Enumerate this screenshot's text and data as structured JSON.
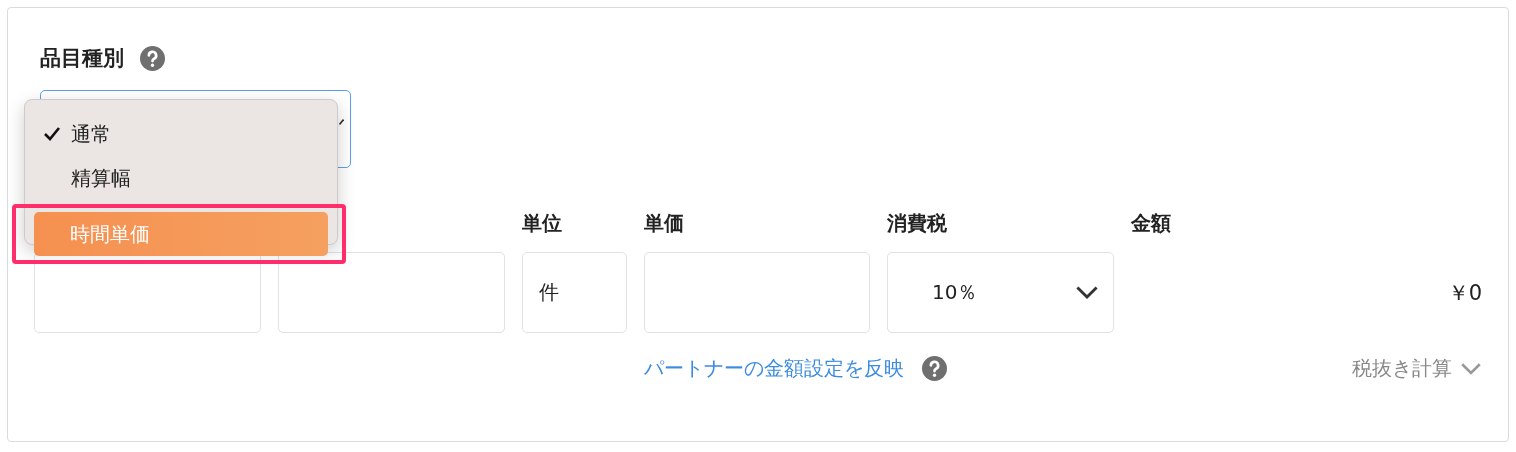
{
  "item_type": {
    "label": "品目種別",
    "menu": [
      {
        "label": "通常",
        "checked": true,
        "selected": false,
        "outlined": false
      },
      {
        "label": "精算幅",
        "checked": false,
        "selected": false,
        "outlined": false
      },
      {
        "label": "時間単価",
        "checked": false,
        "selected": true,
        "outlined": true
      }
    ]
  },
  "line": {
    "fields": [
      {
        "kind": "text"
      },
      {
        "kind": "text"
      },
      {
        "kind": "text",
        "heading": "単位",
        "value": "件"
      },
      {
        "kind": "text",
        "heading": "単価"
      },
      {
        "kind": "select",
        "heading": "消費税",
        "value": "10％"
      },
      {
        "kind": "amount",
        "heading": "金額",
        "value": "￥0"
      }
    ],
    "link": "パートナーの金額設定を反映",
    "calc_mode": "税抜き計算"
  }
}
